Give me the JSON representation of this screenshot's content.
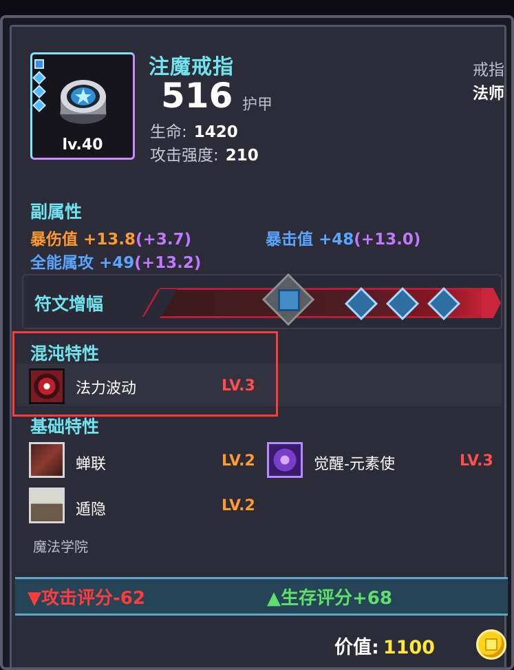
{
  "item": {
    "name": "注魔戒指",
    "level": "lv.40",
    "armor_value": "516",
    "armor_label": "护甲",
    "stats": [
      {
        "label": "生命:",
        "value": "1420"
      },
      {
        "label": "攻击强度:",
        "value": "210"
      }
    ],
    "slot_type": "戒指",
    "class": "法师"
  },
  "sub_attributes": {
    "title": "副属性",
    "items": [
      {
        "name": "暴伤值",
        "value": "+13.8",
        "bonus": "(+3.7)",
        "color": "#ff9a2e"
      },
      {
        "name": "暴击值",
        "value": "+48",
        "bonus": "(+13.0)",
        "color": "#5aa6ff"
      },
      {
        "name": "全能属攻",
        "value": "+49",
        "bonus": "(+13.2)",
        "color": "#5aa6ff"
      }
    ]
  },
  "rune": {
    "label": "符文增幅"
  },
  "chaos_traits": {
    "title": "混沌特性",
    "items": [
      {
        "name": "法力波动",
        "level": "LV.3",
        "icon": "mana-surge-icon"
      }
    ]
  },
  "base_traits": {
    "title": "基础特性",
    "items": [
      {
        "name": "蝉联",
        "level": "LV.2",
        "icon": "chain-icon"
      },
      {
        "name": "觉醒-元素使",
        "level": "LV.3",
        "icon": "elementalist-icon"
      },
      {
        "name": "遁隐",
        "level": "LV.2",
        "icon": "stealth-icon"
      }
    ],
    "set_name": "魔法学院"
  },
  "scores": {
    "attack": {
      "label": "攻击评分-",
      "value": "62",
      "color": "#ff3b3b"
    },
    "survival": {
      "label": "生存评分+",
      "value": "68",
      "color": "#5ee06a"
    }
  },
  "price": {
    "label": "价值:",
    "value": "1100"
  },
  "colors": {
    "lv_orange": "#ff9a2e",
    "lv_red": "#ff4d4d",
    "highlight_red": "#ff3b3b",
    "title_cyan": "#6fe3ee"
  }
}
